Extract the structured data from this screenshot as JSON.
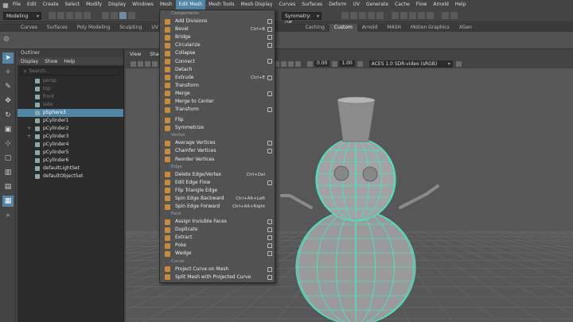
{
  "menubar": {
    "items": [
      "File",
      "Edit",
      "Create",
      "Select",
      "Modify",
      "Display",
      "Windows",
      "Mesh",
      "Edit Mesh",
      "Mesh Tools",
      "Mesh Display",
      "Curves",
      "Surfaces",
      "Deform",
      "UV",
      "Generate",
      "Cache",
      "Flow",
      "Arnold",
      "Help"
    ],
    "active": "Edit Mesh"
  },
  "status": {
    "mode": "Modeling",
    "symmetry": "Symmetry: Off"
  },
  "shelf_tabs": {
    "left": [
      "Curves",
      "Surfaces",
      "Poly Modeling",
      "Sculpting",
      "UV Editing"
    ],
    "right": [
      "Caching",
      "Custom",
      "Arnold",
      "MASH",
      "Motion Graphics",
      "XGen"
    ],
    "active": "Custom"
  },
  "outliner": {
    "title": "Outliner",
    "menus": [
      "Display",
      "Show",
      "Help"
    ],
    "search_placeholder": "Search...",
    "rows": [
      {
        "label": "persp",
        "dim": true
      },
      {
        "label": "top",
        "dim": true
      },
      {
        "label": "front",
        "dim": true
      },
      {
        "label": "side",
        "dim": true
      },
      {
        "label": "pSphere3",
        "selected": true
      },
      {
        "label": "pCylinder1"
      },
      {
        "label": "pCylinder2",
        "expand": "+"
      },
      {
        "label": "pCylinder3",
        "expand": "+"
      },
      {
        "label": "pCylinder4"
      },
      {
        "label": "pCylinder5"
      },
      {
        "label": "pCylinder6"
      },
      {
        "label": "defaultLightSet"
      },
      {
        "label": "defaultObjectSet"
      }
    ]
  },
  "viewport": {
    "menus": [
      "View",
      "Shadi"
    ],
    "value1": "0.00",
    "value2": "1.00",
    "colorspace": "ACES 1.0 SDR-video (sRGB)",
    "accent": "#4fe0c0"
  },
  "edit_mesh_menu": [
    {
      "section": "Components"
    },
    {
      "label": "Add Divisions",
      "icon": "#c98a3a",
      "opt": true
    },
    {
      "label": "Bevel",
      "icon": "#c98a3a",
      "shortcut": "Ctrl+B",
      "opt": true
    },
    {
      "label": "Bridge",
      "icon": "#c98a3a",
      "opt": true
    },
    {
      "label": "Circularize",
      "icon": "#c98a3a",
      "opt": true
    },
    {
      "label": "Collapse",
      "icon": "#c98a3a"
    },
    {
      "label": "Connect",
      "icon": "#c98a3a",
      "opt": true
    },
    {
      "label": "Detach",
      "icon": "#c98a3a"
    },
    {
      "label": "Extrude",
      "icon": "#c98a3a",
      "shortcut": "Ctrl+E",
      "opt": true
    },
    {
      "label": "Transform",
      "icon": "#c98a3a"
    },
    {
      "label": "Merge",
      "icon": "#c98a3a",
      "opt": true
    },
    {
      "label": "Merge to Center",
      "icon": "#c98a3a"
    },
    {
      "label": "Transform",
      "icon": "#c98a3a",
      "opt": true
    },
    {
      "sep": true
    },
    {
      "label": "Flip",
      "icon": "#c98a3a"
    },
    {
      "label": "Symmetrize",
      "icon": "#c98a3a"
    },
    {
      "section": "Vertex"
    },
    {
      "label": "Average Vertices",
      "icon": "#c98a3a",
      "opt": true
    },
    {
      "label": "Chamfer Vertices",
      "icon": "#c98a3a",
      "opt": true
    },
    {
      "label": "Reorder Vertices",
      "icon": "#c98a3a"
    },
    {
      "section": "Edge"
    },
    {
      "label": "Delete Edge/Vertex",
      "icon": "#c98a3a",
      "shortcut": "Ctrl+Del"
    },
    {
      "label": "Edit Edge Flow",
      "icon": "#c98a3a",
      "opt": true
    },
    {
      "label": "Flip Triangle Edge",
      "icon": "#c98a3a"
    },
    {
      "label": "Spin Edge Backward",
      "icon": "#c98a3a",
      "shortcut": "Ctrl+Alt+Left"
    },
    {
      "label": "Spin Edge Forward",
      "icon": "#c98a3a",
      "shortcut": "Ctrl+Alt+Right"
    },
    {
      "section": "Face"
    },
    {
      "label": "Assign Invisible Faces",
      "icon": "#c98a3a",
      "opt": true
    },
    {
      "label": "Duplicate",
      "icon": "#c98a3a",
      "opt": true
    },
    {
      "label": "Extract",
      "icon": "#c98a3a",
      "opt": true
    },
    {
      "label": "Poke",
      "icon": "#c98a3a",
      "opt": true
    },
    {
      "label": "Wedge",
      "icon": "#c98a3a",
      "opt": true
    },
    {
      "section": "Curve"
    },
    {
      "label": "Project Curve on Mesh",
      "icon": "#c98a3a",
      "opt": true
    },
    {
      "label": "Split Mesh with Projected Curve",
      "icon": "#c98a3a",
      "opt": true
    }
  ]
}
